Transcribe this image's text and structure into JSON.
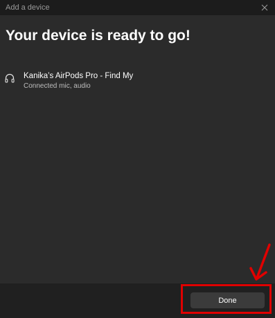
{
  "window": {
    "title": "Add a device",
    "close_icon": "close-icon"
  },
  "main": {
    "heading": "Your device is ready to go!",
    "device": {
      "icon": "headphones-icon",
      "name": "Kanika’s AirPods Pro - Find My",
      "status": "Connected mic, audio"
    }
  },
  "footer": {
    "done_label": "Done"
  },
  "annotation": {
    "color": "#e00000"
  }
}
